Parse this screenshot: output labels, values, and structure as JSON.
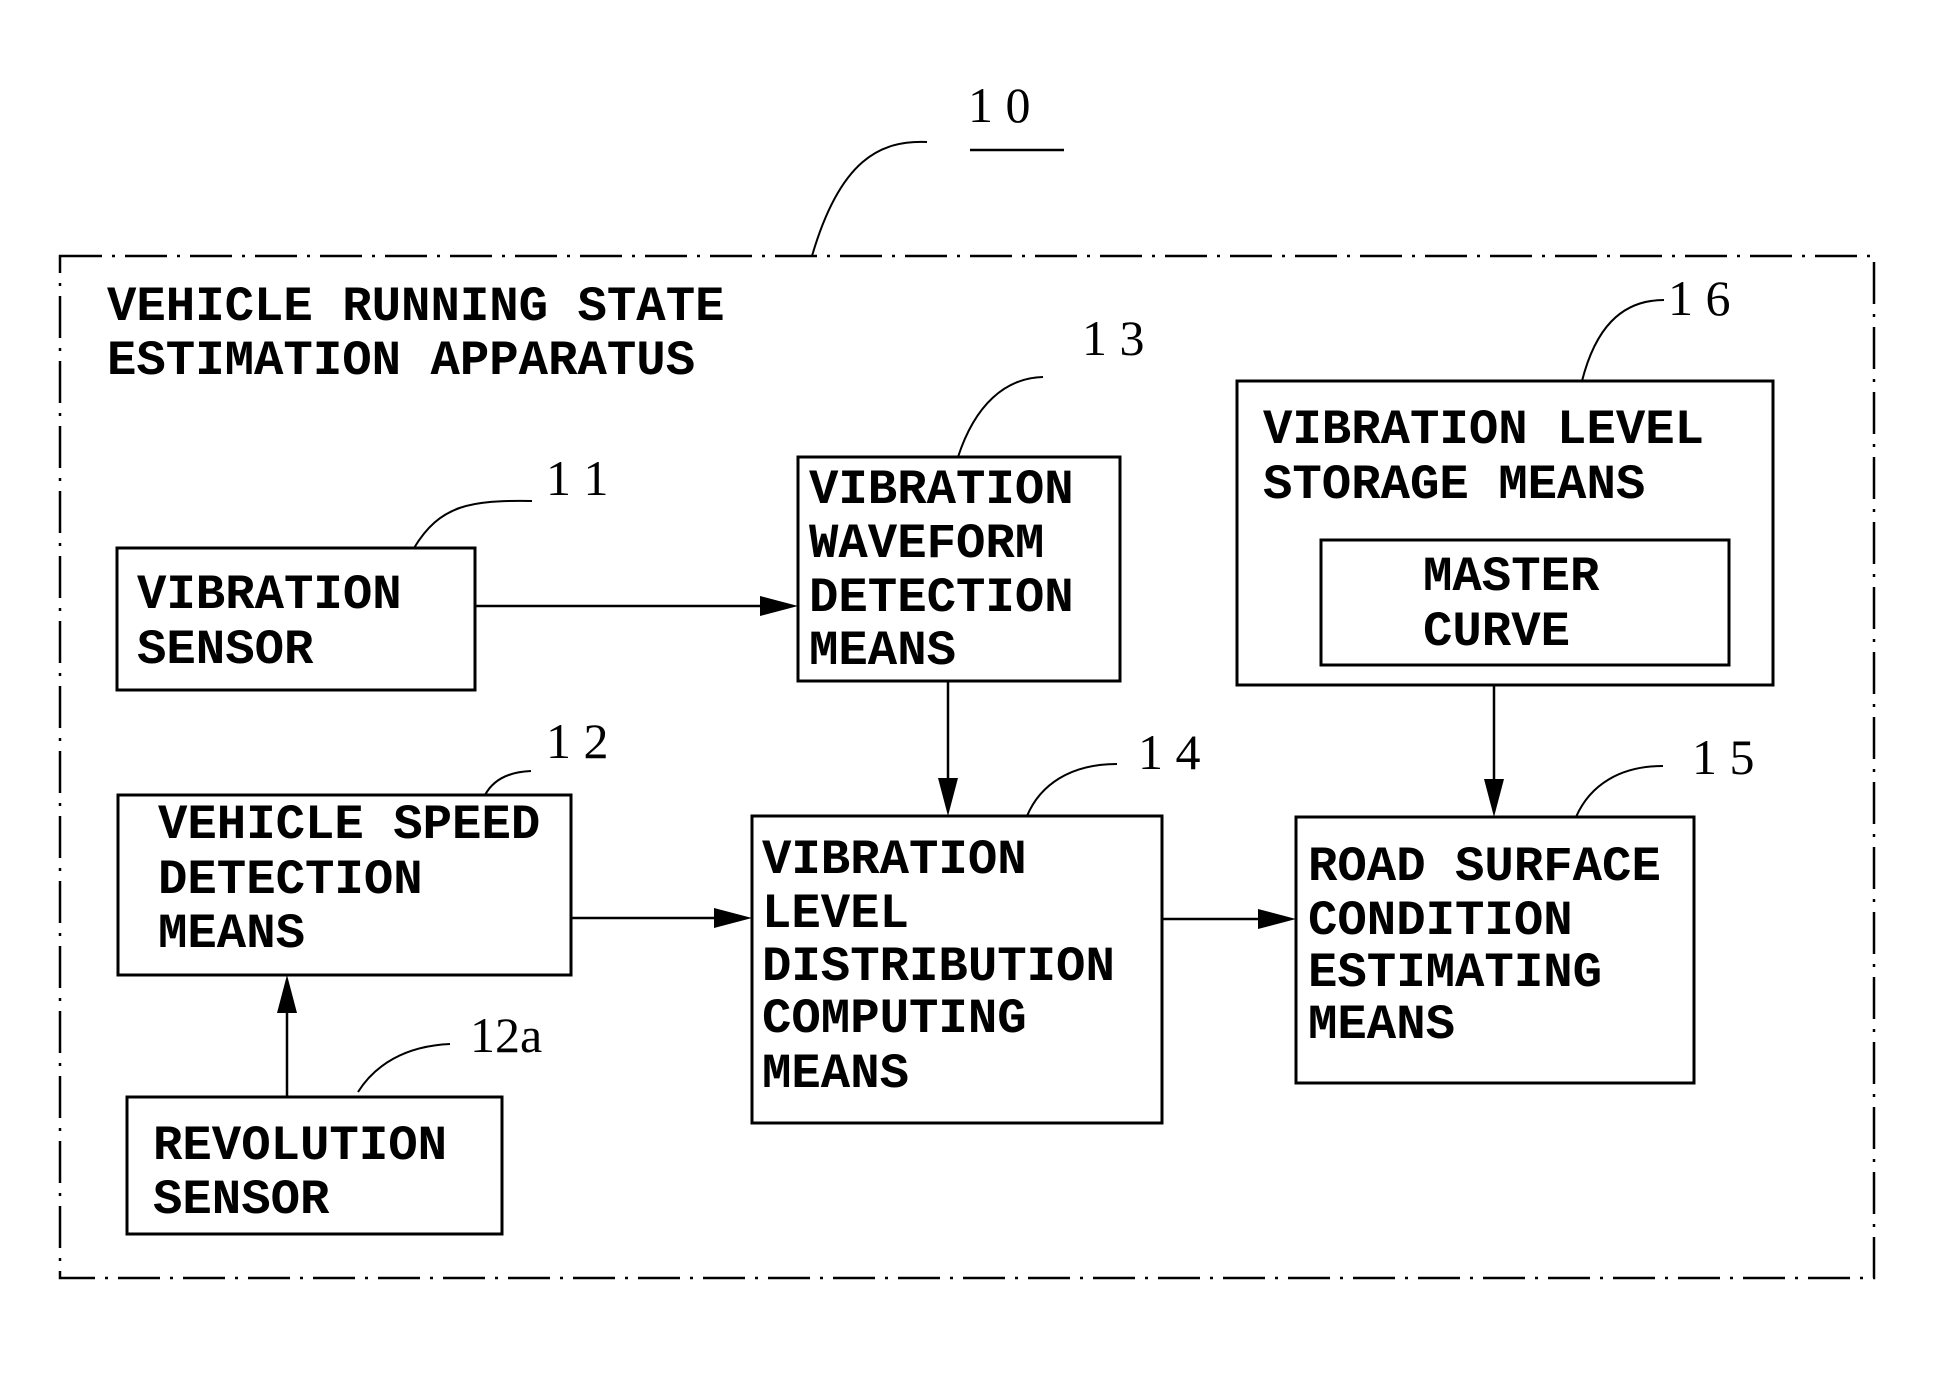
{
  "figure": {
    "reference": "1 0",
    "apparatus_title": [
      "VEHICLE RUNNING STATE",
      "ESTIMATION APPARATUS"
    ]
  },
  "blocks": {
    "vibration_sensor": {
      "ref": "1 1",
      "lines": [
        "VIBRATION",
        "SENSOR"
      ]
    },
    "waveform_detection": {
      "ref": "1 3",
      "lines": [
        "VIBRATION",
        "WAVEFORM",
        "DETECTION",
        "MEANS"
      ]
    },
    "level_storage": {
      "ref": "1 6",
      "lines": [
        "VIBRATION LEVEL",
        "STORAGE MEANS"
      ],
      "inner_lines": [
        "MASTER",
        "CURVE"
      ]
    },
    "speed_detection": {
      "ref": "1 2",
      "lines": [
        "VEHICLE SPEED",
        "DETECTION",
        "MEANS"
      ]
    },
    "distribution_computing": {
      "ref": "1 4",
      "lines": [
        "VIBRATION",
        "LEVEL",
        "DISTRIBUTION",
        "COMPUTING",
        "MEANS"
      ]
    },
    "road_surface": {
      "ref": "1 5",
      "lines": [
        "ROAD SURFACE",
        "CONDITION",
        "ESTIMATING",
        "MEANS"
      ]
    },
    "revolution_sensor": {
      "ref": "12a",
      "lines": [
        "REVOLUTION",
        "SENSOR"
      ]
    }
  },
  "connections": [
    {
      "from": "vibration_sensor",
      "to": "waveform_detection"
    },
    {
      "from": "waveform_detection",
      "to": "distribution_computing"
    },
    {
      "from": "speed_detection",
      "to": "distribution_computing"
    },
    {
      "from": "revolution_sensor",
      "to": "speed_detection"
    },
    {
      "from": "distribution_computing",
      "to": "road_surface"
    },
    {
      "from": "level_storage",
      "to": "road_surface"
    }
  ]
}
